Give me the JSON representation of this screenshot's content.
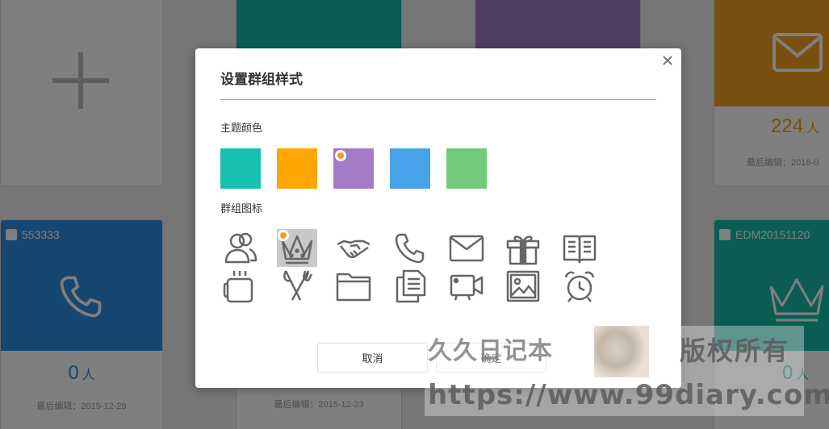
{
  "background_cards": {
    "card_553333": {
      "name": "553333",
      "count": "0",
      "unit": "人",
      "edited": "最后编辑：2015-12-29",
      "color": "#2a8ee0"
    },
    "card_mid": {
      "edited": "最后编辑：2015-12-23"
    },
    "card_224": {
      "count": "224",
      "unit": "人",
      "edited": "最后编辑：2016-0",
      "color": "#f0a020"
    },
    "card_edm": {
      "name": "EDM20151120",
      "count": "0",
      "unit": "人",
      "color": "#17bba8"
    }
  },
  "dialog": {
    "title": "设置群组样式",
    "theme_color_label": "主题颜色",
    "group_icon_label": "群组图标",
    "colors": [
      "#17bfb0",
      "#ffa500",
      "#a27bc4",
      "#47a3e8",
      "#72cb7a"
    ],
    "selected_color_index": 2,
    "icons": [
      "users-icon",
      "crown-icon",
      "handshake-icon",
      "phone-icon",
      "mail-icon",
      "gift-icon",
      "book-icon",
      "coffee-icon",
      "fork-knife-icon",
      "folder-icon",
      "documents-icon",
      "video-icon",
      "image-icon",
      "alarm-clock-icon"
    ],
    "selected_icon_index": 1,
    "cancel_label": "取消",
    "confirm_label": "确定"
  },
  "watermark": {
    "brand_text": "久久日记本",
    "rights_text": "版权所有",
    "url": "https://www.99diary.com"
  }
}
